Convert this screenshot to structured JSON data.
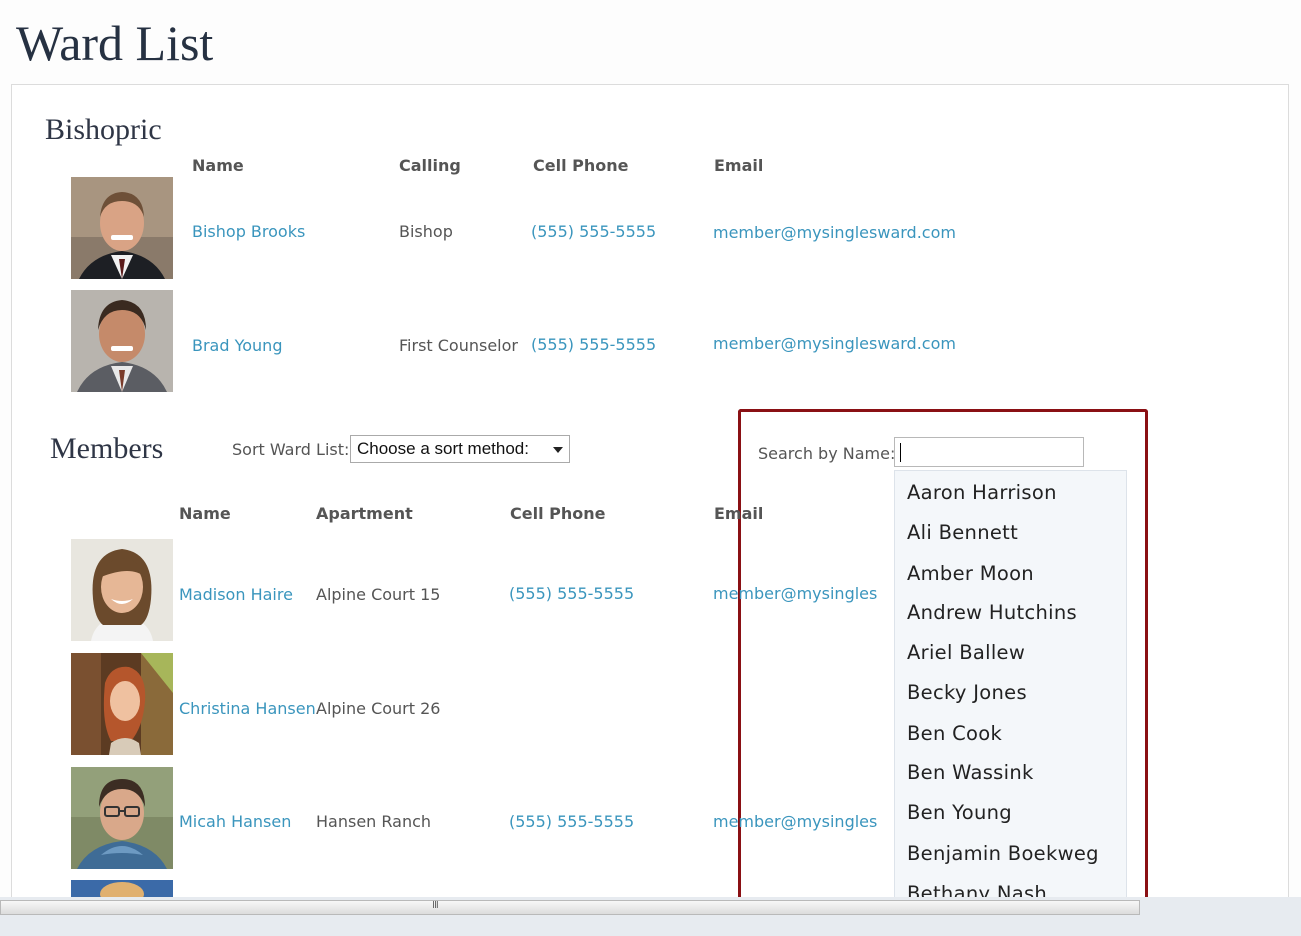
{
  "page": {
    "title": "Ward List"
  },
  "bishopric": {
    "title": "Bishopric",
    "headers": {
      "name": "Name",
      "calling": "Calling",
      "cell": "Cell Phone",
      "email": "Email"
    },
    "rows": [
      {
        "name": "Bishop Brooks",
        "calling": "Bishop",
        "cell": "(555) 555-5555",
        "email": "member@mysinglesward.com"
      },
      {
        "name": "Brad Young",
        "calling": "First Counselor",
        "cell": "(555) 555-5555",
        "email": "member@mysinglesward.com"
      }
    ]
  },
  "members": {
    "title": "Members",
    "sort_label": "Sort Ward List:",
    "sort_value": "Choose a sort method:",
    "search_label": "Search by Name:",
    "search_value": "",
    "headers": {
      "name": "Name",
      "apartment": "Apartment",
      "cell": "Cell Phone",
      "email": "Email"
    },
    "rows": [
      {
        "name": "Madison Haire",
        "apartment": "Alpine Court 15",
        "cell": "(555) 555-5555",
        "email": "member@mysingles"
      },
      {
        "name": "Christina Hansen",
        "apartment": "Alpine Court 26",
        "cell": "",
        "email": ""
      },
      {
        "name": "Micah Hansen",
        "apartment": "Hansen Ranch",
        "cell": "(555) 555-5555",
        "email": "member@mysingles"
      }
    ],
    "suggestions": [
      "Aaron Harrison",
      "Ali Bennett",
      "Amber Moon",
      "Andrew Hutchins",
      "Ariel Ballew",
      "Becky Jones",
      "Ben Cook",
      "Ben Wassink",
      "Ben Young",
      "Benjamin Boekweg",
      "Bethany Nash"
    ]
  },
  "scrollbar": {
    "grip": "III"
  },
  "colors": {
    "link": "#3a95bd",
    "highlight": "#8a1014",
    "title": "#263142"
  }
}
